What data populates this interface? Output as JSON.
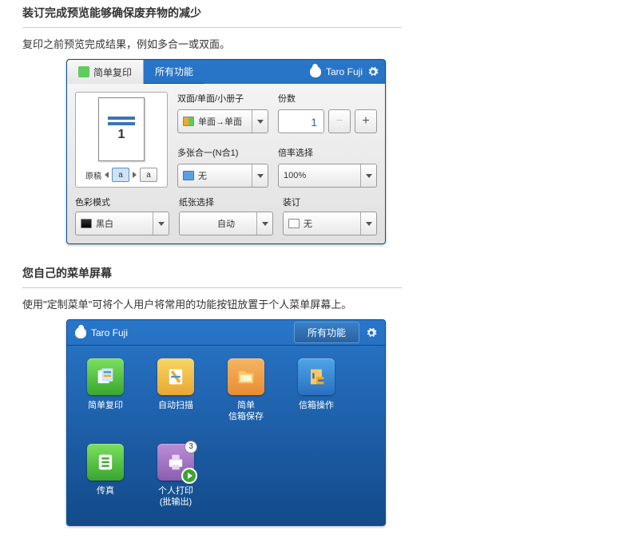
{
  "section1": {
    "title": "装订完成预览能够确保废弃物的减少",
    "desc": "复印之前预览完成结果，例如多合一或双面。"
  },
  "panel1": {
    "tabs": {
      "simple_copy": "简单复印",
      "all_func": "所有功能"
    },
    "user": "Taro Fuji",
    "preview": {
      "page_num": "1",
      "original_label": "原稿",
      "btn_a1": "a",
      "btn_a2": "a"
    },
    "duplex": {
      "label": "双面/单面/小册子",
      "value": "单面→单面"
    },
    "copies": {
      "label": "份数",
      "value": "1"
    },
    "nup": {
      "label": "多张合一(N合1)",
      "value": "无"
    },
    "ratio": {
      "label": "倍率选择",
      "value": "100%"
    },
    "color": {
      "label": "色彩模式",
      "value": "黑白"
    },
    "paper": {
      "label": "纸张选择",
      "value": "自动"
    },
    "bind": {
      "label": "装订",
      "value": "无"
    }
  },
  "section2": {
    "title": "您自己的菜单屏幕",
    "desc": "使用\"定制菜单\"可将个人用户将常用的功能按钮放置于个人菜单屏幕上。"
  },
  "panel2": {
    "user": "Taro Fuji",
    "all_func_btn": "所有功能",
    "icons": {
      "simple_copy": "简单复印",
      "auto_scan": "自动扫描",
      "simple_mailbox": "简单\n信箱保存",
      "mailbox_op": "信箱操作",
      "fax": "传真",
      "personal_print": "个人打印\n(批输出)",
      "badge": "3"
    }
  }
}
